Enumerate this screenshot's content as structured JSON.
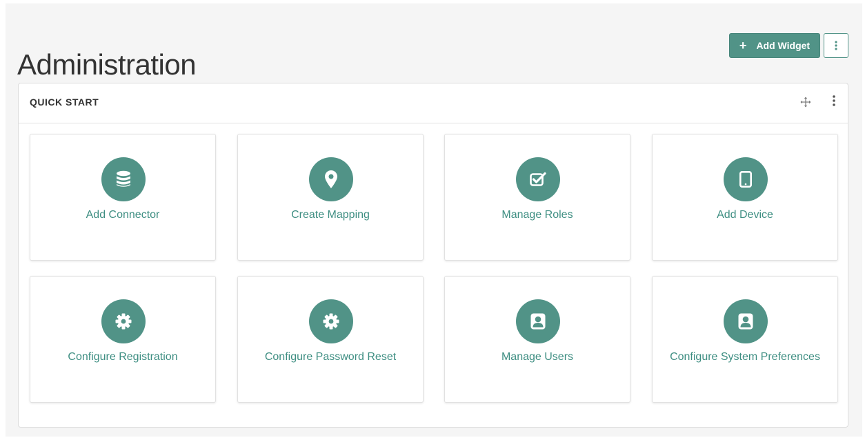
{
  "header": {
    "title": "Administration",
    "add_widget_label": "Add Widget",
    "add_widget_icon": "plus-icon",
    "menu_icon": "kebab-icon"
  },
  "quick_start": {
    "title": "QUICK START",
    "move_icon": "move-icon",
    "menu_icon": "kebab-icon",
    "tiles": [
      {
        "label": "Add Connector",
        "icon": "database-icon"
      },
      {
        "label": "Create Mapping",
        "icon": "map-marker-icon"
      },
      {
        "label": "Manage Roles",
        "icon": "checkbox-icon"
      },
      {
        "label": "Add Device",
        "icon": "tablet-icon"
      },
      {
        "label": "Configure Registration",
        "icon": "gear-icon"
      },
      {
        "label": "Configure Password Reset",
        "icon": "gear-icon"
      },
      {
        "label": "Manage Users",
        "icon": "user-icon"
      },
      {
        "label": "Configure System Preferences",
        "icon": "user-icon"
      }
    ]
  },
  "colors": {
    "accent": "#519387",
    "tile_text": "#3e8e82",
    "background": "#f5f5f5"
  }
}
